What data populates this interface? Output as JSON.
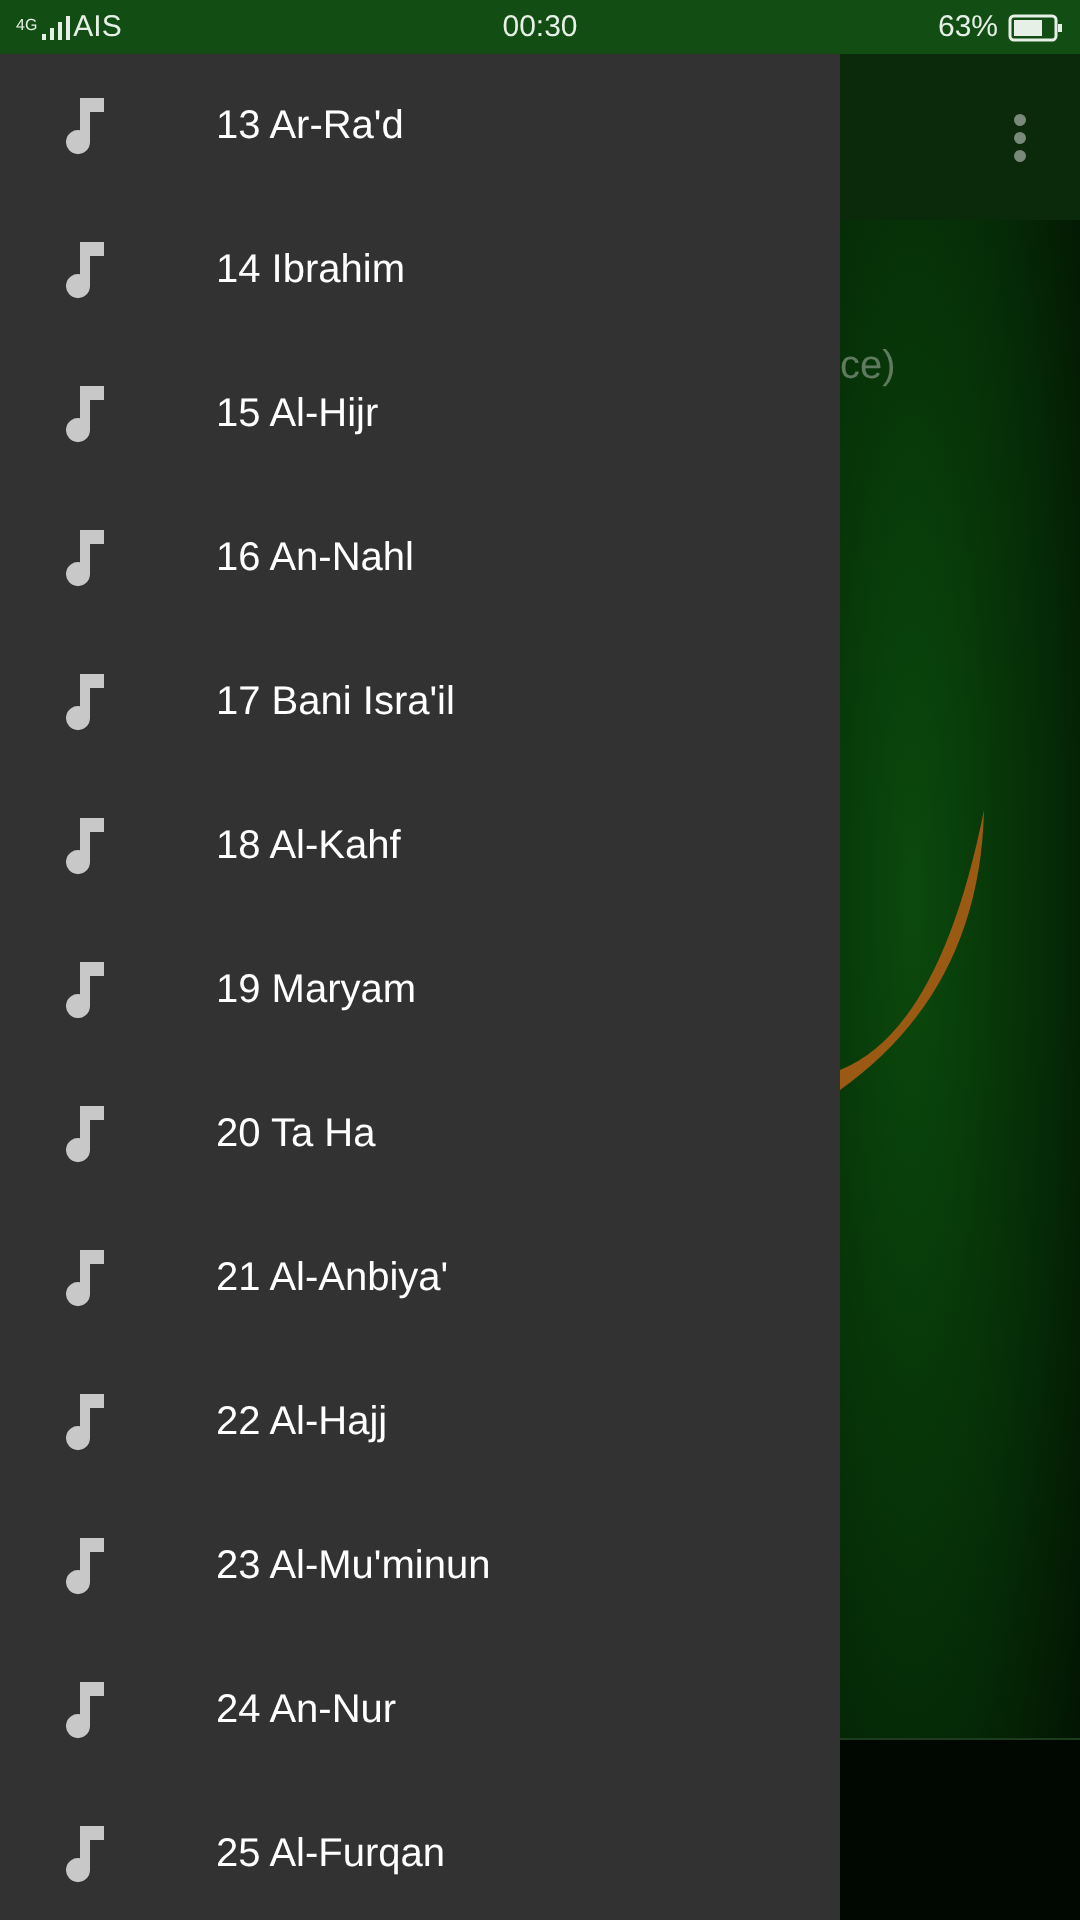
{
  "status_bar": {
    "network": "4G",
    "carrier": "AIS",
    "time": "00:30",
    "battery": "63%"
  },
  "drawer": {
    "items": [
      {
        "label": "13 Ar-Ra'd"
      },
      {
        "label": "14 Ibrahim"
      },
      {
        "label": "15 Al-Hijr"
      },
      {
        "label": "16 An-Nahl"
      },
      {
        "label": "17 Bani Isra'il"
      },
      {
        "label": "18 Al-Kahf"
      },
      {
        "label": "19 Maryam"
      },
      {
        "label": "20 Ta Ha"
      },
      {
        "label": "21 Al-Anbiya'"
      },
      {
        "label": "22 Al-Hajj"
      },
      {
        "label": "23 Al-Mu'minun"
      },
      {
        "label": "24 An-Nur"
      },
      {
        "label": "25 Al-Furqan"
      }
    ]
  },
  "main": {
    "subtitle": "ce)"
  }
}
